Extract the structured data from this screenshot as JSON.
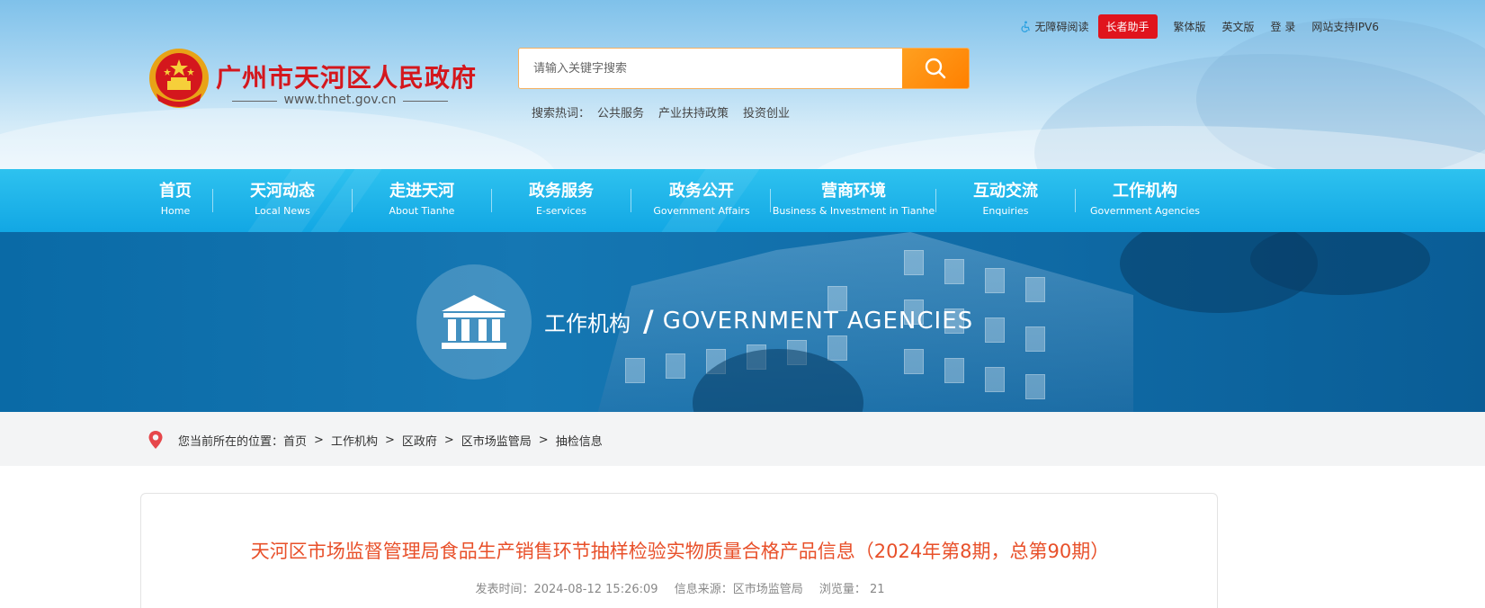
{
  "toplinks": {
    "accessible": "无障碍阅读",
    "elderly": "长者助手",
    "traditional": "繁体版",
    "english": "英文版",
    "login": "登 录",
    "ipv6": "网站支持IPV6"
  },
  "site": {
    "name": "广州市天河区人民政府",
    "url": "www.thnet.gov.cn"
  },
  "search": {
    "placeholder": "请输入关键字搜索",
    "hot_label": "搜索热词：",
    "hot_terms": [
      "公共服务",
      "产业扶持政策",
      "投资创业"
    ]
  },
  "nav": [
    {
      "zh": "首页",
      "en": "Home"
    },
    {
      "zh": "天河动态",
      "en": "Local News"
    },
    {
      "zh": "走进天河",
      "en": "About Tianhe"
    },
    {
      "zh": "政务服务",
      "en": "E-services"
    },
    {
      "zh": "政务公开",
      "en": "Government Affairs"
    },
    {
      "zh": "营商环境",
      "en": "Business & Investment in Tianhe"
    },
    {
      "zh": "互动交流",
      "en": "Enquiries"
    },
    {
      "zh": "工作机构",
      "en": "Government Agencies"
    }
  ],
  "banner": {
    "zh": "工作机构",
    "slash": "/",
    "en": "GOVERNMENT AGENCIES"
  },
  "breadcrumb": {
    "prefix": "您当前所在的位置：",
    "items": [
      "首页",
      "工作机构",
      "区政府",
      "区市场监管局",
      "抽检信息"
    ],
    "separator": ">"
  },
  "article": {
    "title": "天河区市场监督管理局食品生产销售环节抽样检验实物质量合格产品信息（2024年第8期，总第90期）",
    "published": "发表时间：2024-08-12 15:26:09",
    "source": "信息来源：区市场监管局",
    "views": "浏览量： 21"
  },
  "colors": {
    "brand_red": "#d4171d",
    "nav_blue": "#12a7e4",
    "title_orange": "#e8502a",
    "search_orange": "#ff8000"
  },
  "icons": {
    "search": "search-icon",
    "location": "location-pin-icon",
    "building": "government-building-icon",
    "emblem": "national-emblem-icon",
    "accessibility": "wheelchair-icon"
  }
}
